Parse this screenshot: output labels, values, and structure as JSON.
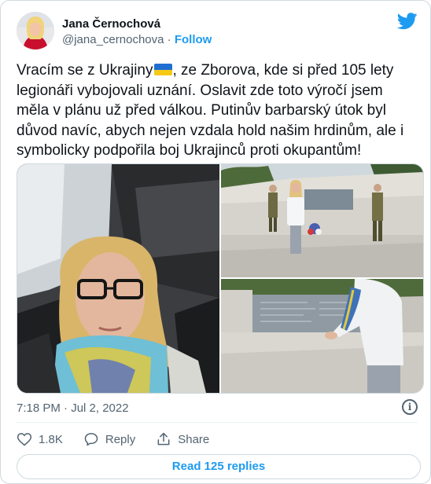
{
  "author": {
    "name": "Jana Černochová",
    "handle": "@jana_cernochova",
    "separator": "·",
    "follow_label": "Follow"
  },
  "tweet": {
    "text_before_flag": "Vracím se z Ukrajiny",
    "flag_icon": "ukraine-flag-icon",
    "text_after_flag": ", ze Zborova, kde si před 105 lety legionáři vybojovali uznání. Oslavit zde toto výročí jsem měla v plánu už před válkou. Putinův barbarský útok byl důvod navíc, abych nejen vzdala hold našim hrdinům, ale i symbolicky podpořila boj Ukrajinců proti okupantům!",
    "timestamp": "7:18 PM · Jul 2, 2022"
  },
  "actions": {
    "like_count": "1.8K",
    "reply_label": "Reply",
    "share_label": "Share"
  },
  "read_replies_label": "Read 125 replies",
  "colors": {
    "accent": "#1d9bf0",
    "text": "#0f1419",
    "muted": "#536471",
    "border": "#cfd9de",
    "flag_blue": "#1f6fd1",
    "flag_yellow": "#f6c915"
  }
}
